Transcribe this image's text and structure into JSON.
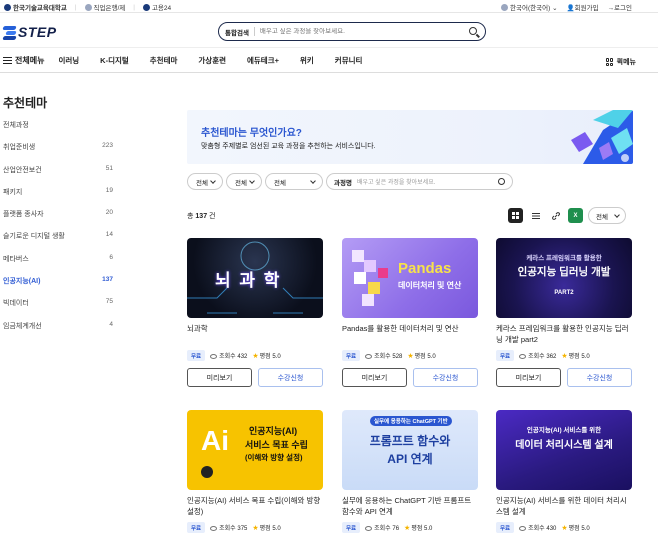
{
  "topbar": {
    "univ": "한국기술교육대학교",
    "bank": "직업은행/제",
    "goyong": "고용24",
    "lang": "한국어(한국어)",
    "join": "회원가입",
    "login": "로그인"
  },
  "header": {
    "logo": "STEP",
    "search_scope": "통합검색",
    "search_placeholder": "배우고 싶은 과정을 찾아보세요."
  },
  "nav": {
    "all_menu": "전체메뉴",
    "items": [
      "이러닝",
      "K-디지털",
      "추천테마",
      "가상훈련",
      "에듀테크+",
      "위키",
      "커뮤니티"
    ],
    "bookmark": "퀵메뉴"
  },
  "sidebar": {
    "title": "추천테마",
    "items": [
      {
        "label": "전체과정",
        "count": ""
      },
      {
        "label": "취업준비생",
        "count": "223"
      },
      {
        "label": "산업안전보건",
        "count": "51"
      },
      {
        "label": "패키지",
        "count": "19"
      },
      {
        "label": "플랫폼 종사자",
        "count": "20"
      },
      {
        "label": "슬기로운 디지털 생활",
        "count": "14"
      },
      {
        "label": "메타버스",
        "count": "6"
      },
      {
        "label": "인공지능(AI)",
        "count": "137"
      },
      {
        "label": "빅데이터",
        "count": "75"
      },
      {
        "label": "임금체계개선",
        "count": "4"
      }
    ],
    "active_index": 7
  },
  "banner": {
    "heading": "추천테마는 무엇인가요?",
    "desc": "맞춤형 주제별로 엄선된 교육 과정을 추천하는 서비스입니다."
  },
  "filters": {
    "sel1": "전체",
    "sel2": "전체",
    "sel3": "전체",
    "search_label": "과정명",
    "search_placeholder": "배우고 싶은 과정을 찾아보세요."
  },
  "list": {
    "total_prefix": "총",
    "total": "137",
    "total_suffix": "건",
    "sort": "전체",
    "excel": "X"
  },
  "cards": [
    {
      "title": "뇌과학",
      "thumb_text": "뇌 과 학",
      "badge": "무료",
      "views_label": "조회수",
      "views": "432",
      "rating_label": "평점",
      "rating": "5.0",
      "btn_preview": "미리보기",
      "btn_apply": "수강신청"
    },
    {
      "title": "Pandas를 활용한 데이터처리 및 연산",
      "thumb_text": "Pandas",
      "thumb_sub": "데이터처리 및 연산",
      "badge": "무료",
      "views_label": "조회수",
      "views": "528",
      "rating_label": "평점",
      "rating": "5.0",
      "btn_preview": "미리보기",
      "btn_apply": "수강신청"
    },
    {
      "title": "케라스 프레임워크를 활용한 인공지능 딥러닝 개발 part2",
      "thumb_text": "케라스 프레임워크를 활용한",
      "thumb_sub": "인공지능 딥러닝 개발",
      "thumb_sub2": "PART2",
      "badge": "무료",
      "views_label": "조회수",
      "views": "362",
      "rating_label": "평점",
      "rating": "5.0",
      "btn_preview": "미리보기",
      "btn_apply": "수강신청"
    },
    {
      "title": "인공지능(AI) 서비스 목표 수립(이해와 방향 설정)",
      "thumb_text": "인공지능(AI)",
      "thumb_sub": "서비스 목표 수립",
      "thumb_sub2": "(이해와 방향 설정)",
      "badge": "무료",
      "views_label": "조회수",
      "views": "375",
      "rating_label": "평점",
      "rating": "5.0"
    },
    {
      "title": "실무에 응용하는 ChatGPT 기반 프롬프트 함수와 API 연계",
      "thumb_text": "실무에 응용하는 ChatGPT 기반",
      "thumb_sub": "프롬프트 함수와",
      "thumb_sub2": "API 연계",
      "badge": "무료",
      "views_label": "조회수",
      "views": "76",
      "rating_label": "평점",
      "rating": "5.0"
    },
    {
      "title": "인공지능(AI) 서비스를 위한 데이터 처리시스템 설계",
      "thumb_text": "인공지능(AI) 서비스를 위한",
      "thumb_sub": "데이터 처리시스템 설계",
      "badge": "무료",
      "views_label": "조회수",
      "views": "430",
      "rating_label": "평점",
      "rating": "5.0"
    }
  ],
  "colors": {
    "accent": "#2a56d0",
    "navy": "#13204a"
  }
}
